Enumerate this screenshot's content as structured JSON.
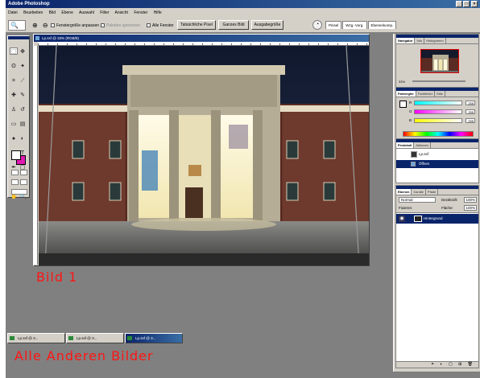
{
  "app": {
    "title": "Adobe Photoshop",
    "window_controls": [
      "_",
      "□",
      "×"
    ]
  },
  "menu": [
    "Datei",
    "Bearbeiten",
    "Bild",
    "Ebene",
    "Auswahl",
    "Filter",
    "Ansicht",
    "Fenster",
    "Hilfe"
  ],
  "options": {
    "tool_glyph": "🔍",
    "zoom_glyphs": "⊕ ⊖",
    "fit_window": "Fenstergröße anpassen",
    "ignore_palettes": "Paletten ignorieren",
    "all_windows": "Alle Fenster",
    "actual_pixels": "Tatsächliche Pixel",
    "fit_screen": "Ganzes Bild",
    "print_size": "Ausgabegröße",
    "well_tabs": [
      "Pinsel",
      "Wzg.-Vorg.",
      "Ebenenkomp."
    ]
  },
  "document": {
    "title": "Lp.ssf @ 33% (RGB/8)"
  },
  "captions": {
    "bild1": "Bild 1",
    "others": "Alle Anderen Bilder"
  },
  "taskbar": [
    {
      "label": "Lp.ssf @ 3..."
    },
    {
      "label": "Lp.ssf @ 3..."
    },
    {
      "label": "Lp.ssf @ 3..."
    }
  ],
  "palettes": {
    "navigator": {
      "tabs": [
        "Navigator",
        "Info",
        "Histogramm"
      ],
      "zoom": "33%"
    },
    "color": {
      "tabs": [
        "Farbregler",
        "Farbfelder",
        "Stile"
      ],
      "channels": [
        {
          "label": "R",
          "value": "255",
          "color": "#ff0000"
        },
        {
          "label": "G",
          "value": "255",
          "color": "#00ff00"
        },
        {
          "label": "B",
          "value": "255",
          "color": "#0000ff"
        }
      ]
    },
    "history": {
      "tabs": [
        "Protokoll",
        "Aktionen"
      ],
      "items": [
        "Lp.ssf",
        "Öffnen"
      ]
    },
    "layers": {
      "tabs": [
        "Ebenen",
        "Kanäle",
        "Pfade"
      ],
      "blend_mode": "Normal",
      "opacity_label": "Deckkraft:",
      "opacity": "100%",
      "lock_label": "Fixieren:",
      "fill_label": "Fläche:",
      "fill": "100%",
      "layer_name": "Hintergrund"
    }
  }
}
